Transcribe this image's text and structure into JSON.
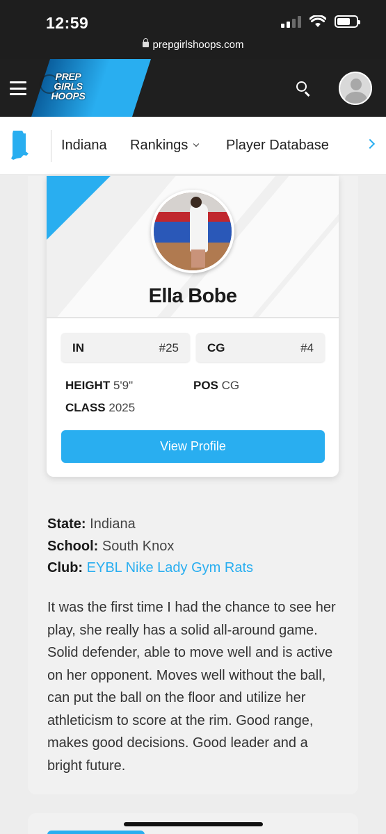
{
  "status_bar": {
    "time": "12:59",
    "url": "prepgirlshoops.com"
  },
  "header": {
    "logo_lines": [
      "PREP",
      "GIRLS",
      "HOOPS"
    ],
    "menu_icon": "hamburger-icon",
    "search_icon": "search-icon",
    "avatar_icon": "user-avatar-icon"
  },
  "subnav": {
    "state_icon": "indiana-state-icon",
    "items": [
      {
        "label": "Indiana"
      },
      {
        "label": "Rankings",
        "has_dropdown": true
      },
      {
        "label": "Player Database"
      }
    ],
    "next_icon": "chevron-right-icon"
  },
  "player": {
    "name": "Ella Bobe",
    "ranks": [
      {
        "key": "IN",
        "value": "#25"
      },
      {
        "key": "CG",
        "value": "#4"
      }
    ],
    "height_label": "HEIGHT",
    "height_value": "5'9\"",
    "pos_label": "POS",
    "pos_value": "CG",
    "class_label": "CLASS",
    "class_value": "2025",
    "view_profile": "View Profile"
  },
  "details": {
    "state_label": "State:",
    "state_value": "Indiana",
    "school_label": "School:",
    "school_value": "South Knox",
    "club_label": "Club:",
    "club_value": "EYBL Nike Lady Gym Rats"
  },
  "description": "It was the first time I had the chance to see her play, she really has a solid all-around game. Solid defender, able to move well and is active on her opponent. Moves well without the ball, can put the ball on the floor and utilize her athleticism to score at the rim. Good range, makes good decisions. Good leader and a bright future.",
  "colors": {
    "accent": "#29aef0",
    "header_bg": "#1f1f1f"
  }
}
